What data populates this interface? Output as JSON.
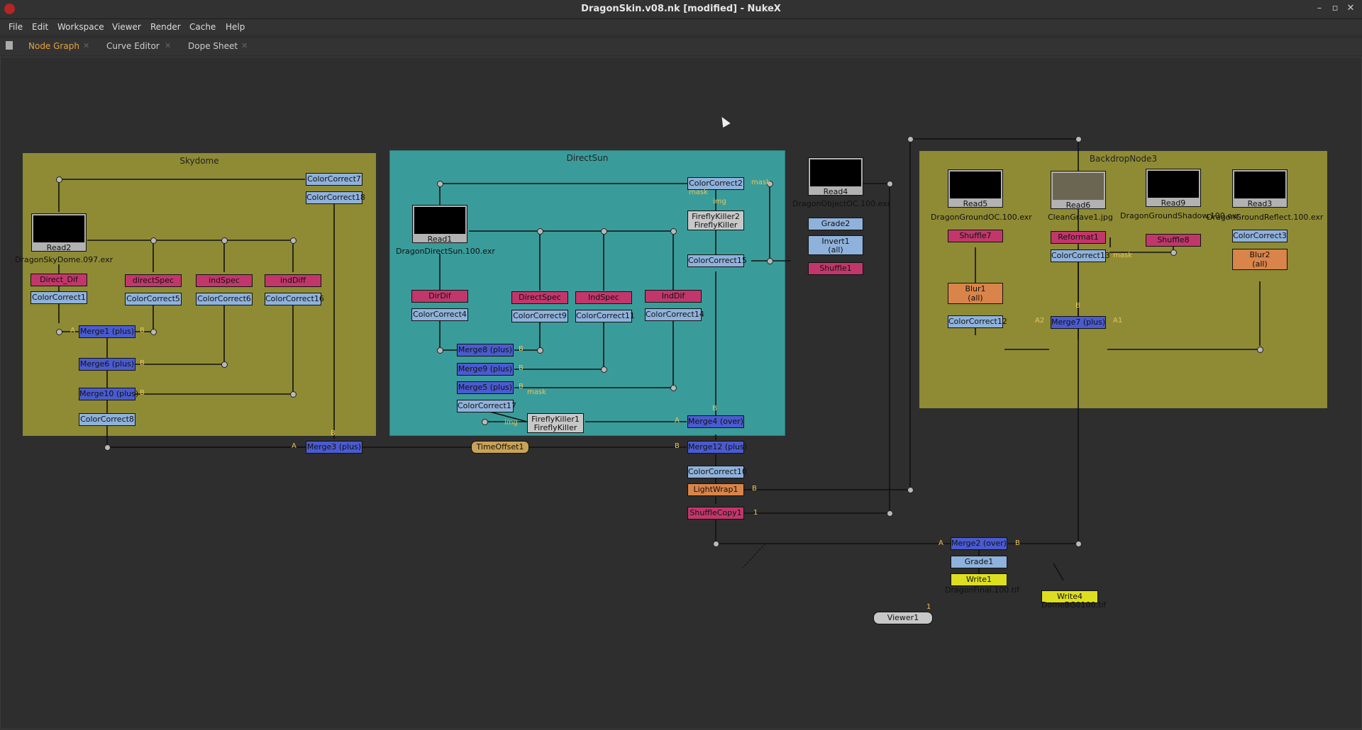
{
  "window": {
    "title": "DragonSkin.v08.nk [modified] - NukeX"
  },
  "menu": [
    "File",
    "Edit",
    "Workspace",
    "Viewer",
    "Render",
    "Cache",
    "Help"
  ],
  "tabs": [
    {
      "label": "Node Graph"
    },
    {
      "label": "Curve Editor"
    },
    {
      "label": "Dope Sheet"
    }
  ],
  "backdrops": {
    "skydome": "Skydome",
    "directsun": "DirectSun",
    "backdrop3": "BackdropNode3"
  },
  "nodes": {
    "read2": "Read2",
    "read2_file": "DragonSkyDome.097.exr",
    "direct_dif": "Direct_Dif",
    "directspec_s": "directSpec",
    "indspec_s": "indSpec",
    "inddiff_s": "indDiff",
    "cc1": "ColorCorrect1",
    "cc5": "ColorCorrect5",
    "cc6": "ColorCorrect6",
    "cc16": "ColorCorrect16",
    "cc7": "ColorCorrect7",
    "cc18": "ColorCorrect18",
    "merge1": "Merge1 (plus)",
    "merge6": "Merge6 (plus)",
    "merge10": "Merge10 (plus)",
    "cc8": "ColorCorrect8",
    "read1": "Read1",
    "read1_file": "DragonDirectSun.100.exr",
    "dirdif": "DirDif",
    "directspec": "DirectSpec",
    "indspec": "IndSpec",
    "inddif": "IndDif",
    "cc4": "ColorCorrect4",
    "cc9": "ColorCorrect9",
    "cc11": "ColorCorrect11",
    "cc14": "ColorCorrect14",
    "merge8": "Merge8 (plus)",
    "merge9": "Merge9 (plus)",
    "merge5": "Merge5 (plus)",
    "cc17": "ColorCorrect17",
    "ff1": "FireflyKiller1",
    "ff1_class": "FireflyKiller",
    "cc2": "ColorCorrect2",
    "ff2": "FireflyKiller2",
    "ff2_class": "FireflyKiller",
    "cc15": "ColorCorrect15",
    "read4": "Read4",
    "read4_file": "DragonObjectOC.100.exr",
    "grade2": "Grade2",
    "invert1": "Invert1",
    "invert1_sub": "(all)",
    "shuffle1": "Shuffle1",
    "read5": "Read5",
    "read5_file": "DragonGroundOC.100.exr",
    "shuffle7": "Shuffle7",
    "blur1": "Blur1",
    "blur1_sub": "(all)",
    "cc12": "ColorCorrect12",
    "read6": "Read6",
    "read6_file": "CleanGrave1.jpg",
    "reformat1": "Reformat1",
    "cc13": "ColorCorrect13",
    "merge7": "Merge7 (plus)",
    "read9": "Read9",
    "read9_file": "DragonGroundShadow.100.exr",
    "shuffle8": "Shuffle8",
    "read3": "Read3",
    "read3_file": "DragonGroundReflect.100.exr",
    "cc3": "ColorCorrect3",
    "blur2": "Blur2",
    "blur2_sub": "(all)",
    "merge3": "Merge3 (plus)",
    "timeoffset1": "TimeOffset1",
    "merge4": "Merge4 (over)",
    "merge12": "Merge12 (plus)",
    "cc10": "ColorCorrect10",
    "lightwrap1": "LightWrap1",
    "shufflecopy1": "ShuffleCopy1",
    "merge2": "Merge2 (over)",
    "grade1": "Grade1",
    "write1": "Write1",
    "write1_file": "DragonFinal.100.tif",
    "write4": "Write4",
    "write4_file": "DomeBG0100.tif",
    "viewer1": "Viewer1"
  },
  "pins": {
    "a": "A",
    "b": "B",
    "a1": "A1",
    "a2": "A2",
    "one": "1",
    "mask": "mask",
    "img": "img"
  }
}
